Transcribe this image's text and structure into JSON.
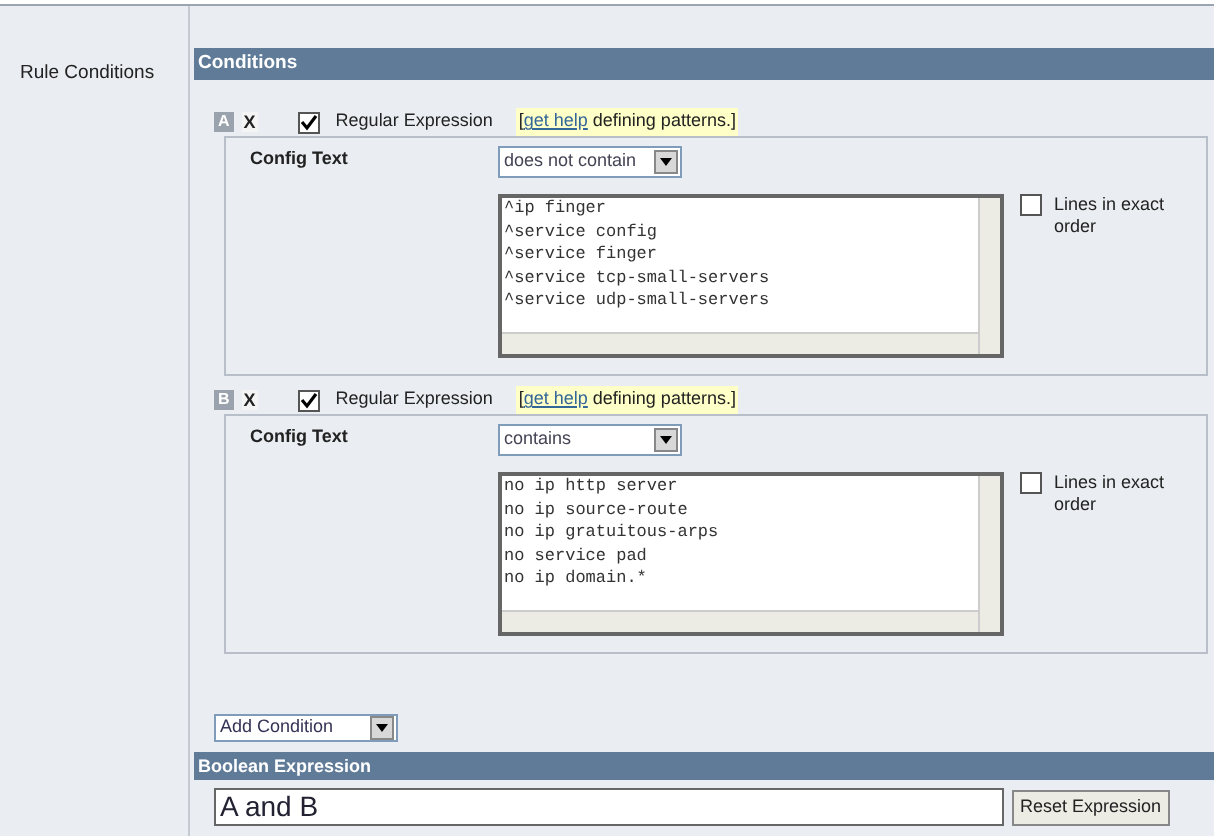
{
  "sidebar": {
    "label": "Rule Conditions"
  },
  "conditions_panel": {
    "title": "Conditions",
    "conditions": [
      {
        "letter": "A",
        "remove": "X",
        "regex_label": "Regular Expression",
        "regex_checked": true,
        "help": {
          "open": "[",
          "link": "get help",
          "rest": "defining patterns.]"
        },
        "field_label": "Config Text",
        "operator": "does not contain",
        "lines": [
          "^ip finger",
          "^service config",
          "^service finger",
          "^service tcp-small-servers",
          "^service udp-small-servers"
        ],
        "exact_order_label": "Lines in exact order",
        "exact_order_checked": false
      },
      {
        "letter": "B",
        "remove": "X",
        "regex_label": "Regular Expression",
        "regex_checked": true,
        "help": {
          "open": "[",
          "link": "get help",
          "rest": "defining patterns.]"
        },
        "field_label": "Config Text",
        "operator": "contains",
        "lines": [
          "no ip http server",
          "no ip source-route",
          "no ip gratuitous-arps",
          "no service pad",
          "no ip domain.*"
        ],
        "exact_order_label": "Lines in exact order",
        "exact_order_checked": false
      }
    ],
    "add_condition": "Add Condition"
  },
  "boolean_panel": {
    "title": "Boolean Expression",
    "expression": "A and B",
    "reset_button": "Reset Expression"
  }
}
